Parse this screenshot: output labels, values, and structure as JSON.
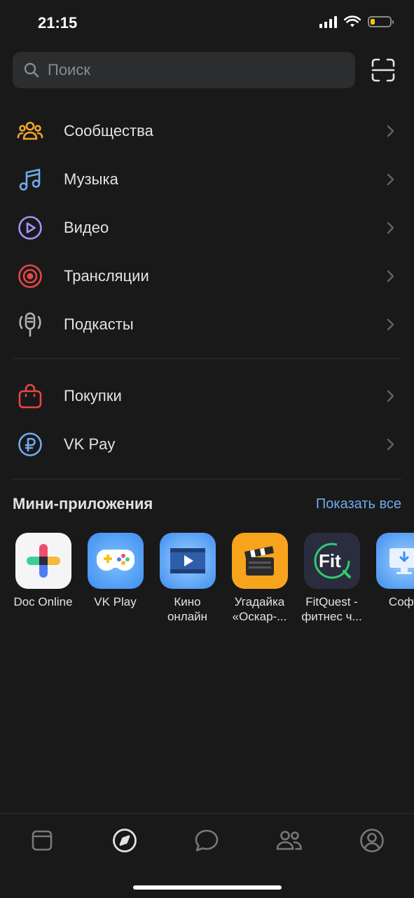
{
  "status": {
    "time": "21:15"
  },
  "search": {
    "placeholder": "Поиск"
  },
  "menu": {
    "items": [
      {
        "label": "Сообщества",
        "icon": "communities-icon",
        "color": "#f0a430"
      },
      {
        "label": "Музыка",
        "icon": "music-icon",
        "color": "#71aaeb"
      },
      {
        "label": "Видео",
        "icon": "video-icon",
        "color": "#a393f5"
      },
      {
        "label": "Трансляции",
        "icon": "live-icon",
        "color": "#e64646"
      },
      {
        "label": "Подкасты",
        "icon": "podcast-icon",
        "color": "#b2b2b2"
      }
    ],
    "items2": [
      {
        "label": "Покупки",
        "icon": "shopping-bag-icon",
        "color": "#e64646"
      },
      {
        "label": "VK Pay",
        "icon": "vkpay-icon",
        "color": "#71aaeb"
      }
    ]
  },
  "mini_apps": {
    "title": "Мини-приложения",
    "show_all": "Показать все",
    "apps": [
      {
        "label": "Doc Online"
      },
      {
        "label": "VK Play"
      },
      {
        "label": "Кино онлайн"
      },
      {
        "label": "Угадайка «Оскар-..."
      },
      {
        "label": "FitQuest - фитнес ч..."
      },
      {
        "label": "Софт"
      }
    ]
  },
  "colors": {
    "background": "#19191a",
    "accent": "#71aaeb",
    "text": "#e1e3e6"
  }
}
